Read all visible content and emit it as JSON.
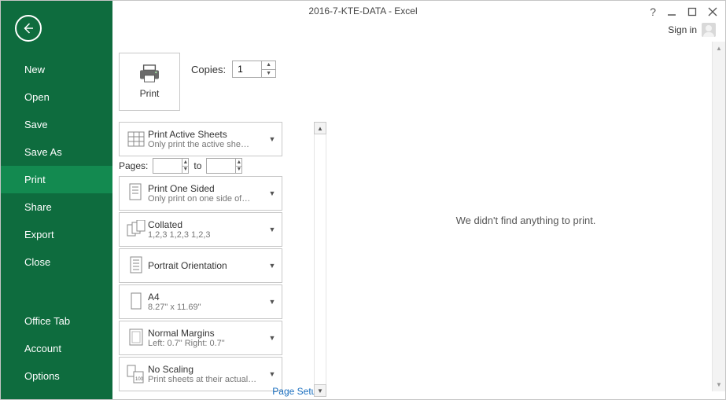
{
  "titlebar": {
    "title": "2016-7-KTE-DATA - Excel",
    "help_glyph": "?",
    "signin_label": "Sign in"
  },
  "sidebar": {
    "items": [
      {
        "label": "New"
      },
      {
        "label": "Open"
      },
      {
        "label": "Save"
      },
      {
        "label": "Save As"
      },
      {
        "label": "Print",
        "active": true
      },
      {
        "label": "Share"
      },
      {
        "label": "Export"
      },
      {
        "label": "Close"
      }
    ],
    "footer_items": [
      {
        "label": "Office Tab"
      },
      {
        "label": "Account"
      },
      {
        "label": "Options"
      }
    ]
  },
  "print": {
    "tile_label": "Print",
    "copies_label": "Copies:",
    "copies_value": "1",
    "pages_label": "Pages:",
    "pages_to_label": "to",
    "page_setup_link": "Page Setup",
    "options": [
      {
        "title": "Print Active Sheets",
        "sub": "Only print the active she…"
      },
      {
        "title": "Print One Sided",
        "sub": "Only print on one side of…"
      },
      {
        "title": "Collated",
        "sub": "1,2,3    1,2,3    1,2,3"
      },
      {
        "title": "Portrait Orientation",
        "sub": ""
      },
      {
        "title": "A4",
        "sub": "8.27\" x 11.69\""
      },
      {
        "title": "Normal Margins",
        "sub": "Left:  0.7\"     Right:  0.7\""
      },
      {
        "title": "No Scaling",
        "sub": "Print sheets at their actual…"
      }
    ]
  },
  "preview": {
    "empty_message": "We didn't find anything to print."
  }
}
